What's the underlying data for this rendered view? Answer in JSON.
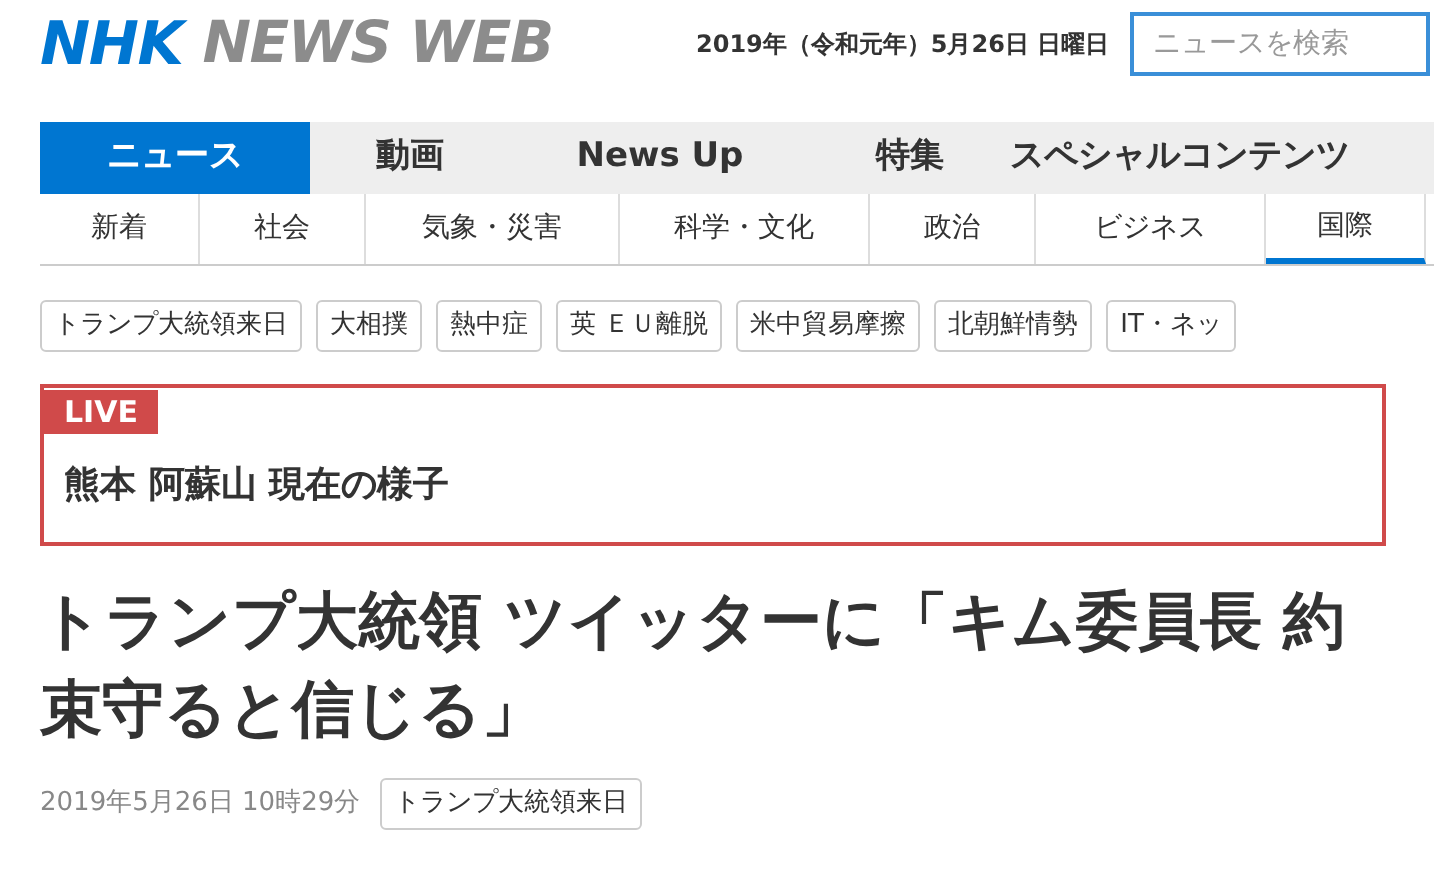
{
  "header": {
    "logo_mark": "NHK",
    "logo_text": "NEWS WEB",
    "date": "2019年（令和元年）5月26日 日曜日",
    "search": {
      "placeholder": "ニュースを検索"
    }
  },
  "main_nav": [
    {
      "label": "ニュース",
      "selected": true
    },
    {
      "label": "動画",
      "selected": false
    },
    {
      "label": "News Up",
      "selected": false
    },
    {
      "label": "特集",
      "selected": false
    },
    {
      "label": "スペシャルコンテンツ",
      "selected": false
    }
  ],
  "sub_nav": [
    {
      "label": "新着",
      "selected": false
    },
    {
      "label": "社会",
      "selected": false
    },
    {
      "label": "気象・災害",
      "selected": false
    },
    {
      "label": "科学・文化",
      "selected": false
    },
    {
      "label": "政治",
      "selected": false
    },
    {
      "label": "ビジネス",
      "selected": false
    },
    {
      "label": "国際",
      "selected": true
    }
  ],
  "topic_tags": [
    "トランプ大統領来日",
    "大相撲",
    "熱中症",
    "英 ＥＵ離脱",
    "米中貿易摩擦",
    "北朝鮮情勢",
    "IT・ネッ"
  ],
  "live": {
    "badge": "LIVE",
    "title": "熊本 阿蘇山 現在の様子"
  },
  "article": {
    "headline": "トランプ大統領 ツイッターに「キム委員長 約束守ると信じる」",
    "timestamp": "2019年5月26日 10時29分",
    "tag": "トランプ大統領来日"
  }
}
